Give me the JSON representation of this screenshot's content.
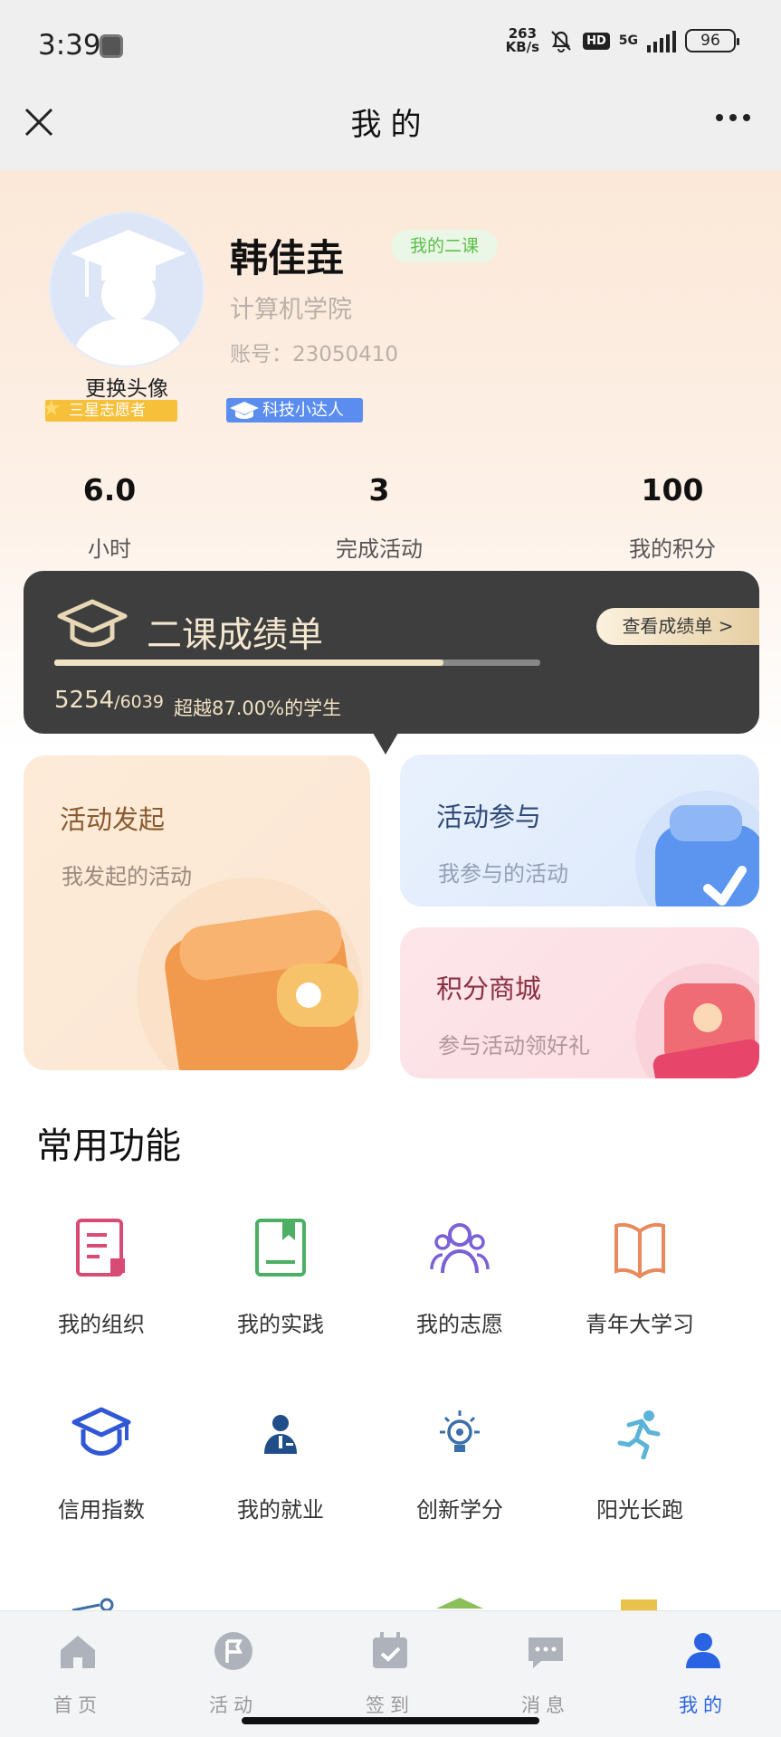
{
  "status_bar": {
    "time": "3:39",
    "net_rate_value": "263",
    "net_rate_unit": "KB/s",
    "hd": "HD",
    "network": "5G",
    "battery": "96"
  },
  "header": {
    "title": "我的"
  },
  "profile": {
    "name": "韩佳垚",
    "tag": "我的二课",
    "college": "计算机学院",
    "account": "账号：23050410",
    "change_avatar": "更换头像",
    "badge_star": "三星志愿者",
    "badge_tech": "科技小达人"
  },
  "stats": [
    {
      "value": "6.0",
      "label": "小时"
    },
    {
      "value": "3",
      "label": "完成活动"
    },
    {
      "value": "100",
      "label": "我的积分"
    }
  ],
  "report": {
    "title": "二课成绩单",
    "button": "查看成绩单 >",
    "score": "5254",
    "total": "/6039",
    "beat": "超越87.00%的学生",
    "progress": 0.8
  },
  "cards": {
    "launch": {
      "title": "活动发起",
      "subtitle": "我发起的活动"
    },
    "join": {
      "title": "活动参与",
      "subtitle": "我参与的活动"
    },
    "mall": {
      "title": "积分商城",
      "subtitle": "参与活动领好礼"
    }
  },
  "functions": {
    "title": "常用功能",
    "items": [
      {
        "label": "我的组织",
        "icon": "document-icon"
      },
      {
        "label": "我的实践",
        "icon": "book-icon"
      },
      {
        "label": "我的志愿",
        "icon": "people-icon"
      },
      {
        "label": "青年大学习",
        "icon": "open-book-icon"
      },
      {
        "label": "信用指数",
        "icon": "graduation-cap-icon"
      },
      {
        "label": "我的就业",
        "icon": "worker-icon"
      },
      {
        "label": "创新学分",
        "icon": "lightbulb-icon"
      },
      {
        "label": "阳光长跑",
        "icon": "runner-icon"
      }
    ]
  },
  "tabbar": [
    {
      "label": "首页",
      "icon": "home-icon"
    },
    {
      "label": "活动",
      "icon": "flag-icon"
    },
    {
      "label": "签到",
      "icon": "calendar-check-icon"
    },
    {
      "label": "消息",
      "icon": "message-icon"
    },
    {
      "label": "我的",
      "icon": "user-icon"
    }
  ],
  "colors": {
    "accent": "#2b64e3",
    "report_bg": "#3e3e3e",
    "gold": "#efe1c3"
  }
}
